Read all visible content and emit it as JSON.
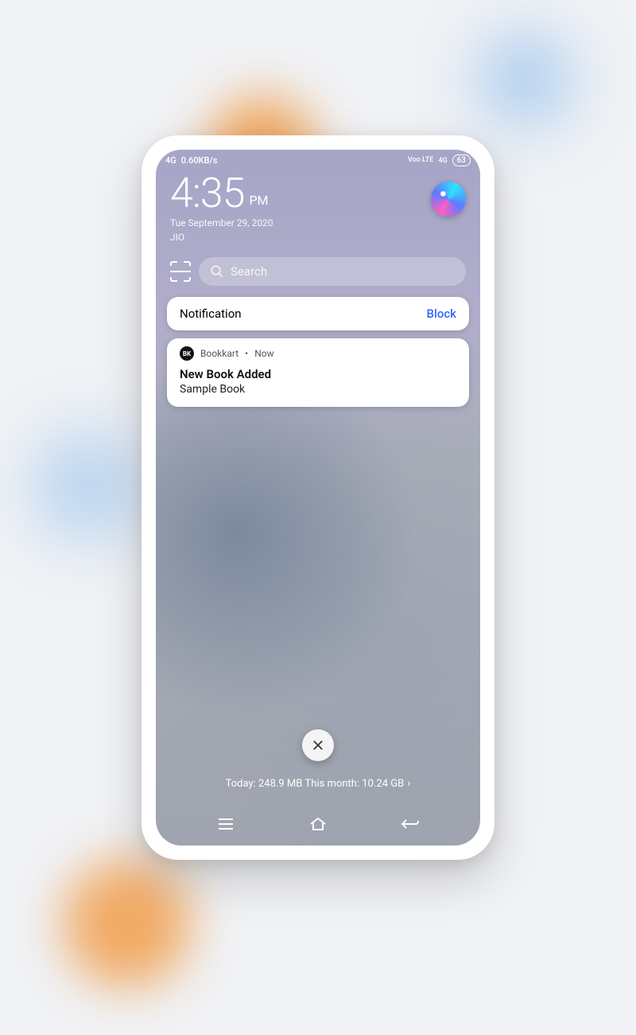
{
  "status_bar": {
    "network_type": "4G",
    "data_speed": "0.60KB/s",
    "lte_label": "Voo LTE",
    "lte_gen": "4G",
    "battery": "63"
  },
  "lock_screen": {
    "time": "4:35",
    "ampm": "PM",
    "date": "Tue September 29, 2020",
    "carrier": "JIO"
  },
  "search": {
    "placeholder": "Search"
  },
  "notification_header": {
    "title": "Notification",
    "action": "Block"
  },
  "notification": {
    "app_icon_text": "BK",
    "app_name": "Bookkart",
    "time": "Now",
    "title": "New Book Added",
    "body": "Sample Book"
  },
  "data_usage": {
    "today_label": "Today:",
    "today_value": "248.9 MB",
    "month_label": "This month:",
    "month_value": "10.24 GB"
  }
}
